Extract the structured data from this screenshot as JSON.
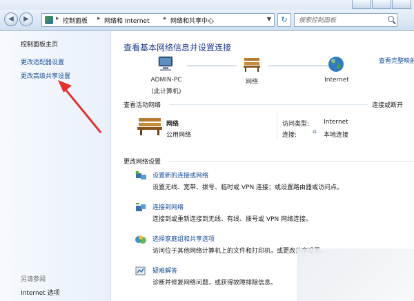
{
  "address": {
    "crumbs": [
      "控制面板",
      "网络和 Internet",
      "网络和共享中心"
    ],
    "search_placeholder": "搜索控制面板"
  },
  "sidebar": {
    "home": "控制面板主页",
    "links": [
      "更改适配器设置",
      "更改高级共享设置"
    ],
    "see_also": "另请参阅",
    "bottom_links": [
      "Internet 选项"
    ]
  },
  "main": {
    "title": "查看基本网络信息并设置连接",
    "see_full_map": "查看完整映射",
    "map": {
      "computer_name": "ADMIN-PC",
      "computer_sub": "(此计算机)",
      "network": "网络",
      "internet": "Internet"
    },
    "active_section": "查看活动网络",
    "connect_disconnect": "连接或断开",
    "active": {
      "name": "网络",
      "type": "公用网络",
      "access_label": "访问类型:",
      "access_value": "Internet",
      "connect_label": "连接:",
      "connect_value": "本地连接"
    },
    "change_section": "更改网络设置",
    "tasks": [
      {
        "title": "设置新的连接或网络",
        "desc": "设置无线、宽带、拨号、临时或 VPN 连接；或设置路由器或访问点。"
      },
      {
        "title": "连接到网络",
        "desc": "连接到或重新连接到无线、有线、拨号或 VPN 网络连接。"
      },
      {
        "title": "选择家庭组和共享选项",
        "desc": "访问位于其他网络计算机上的文件和打印机，或更改共享设置。"
      },
      {
        "title": "疑难解答",
        "desc": "诊断并修复网络问题，或获得故障排除信息。"
      }
    ]
  },
  "colors": {
    "link": "#1a4f9a",
    "title": "#1e3c8a",
    "annotation_arrow": "#e8302a"
  }
}
